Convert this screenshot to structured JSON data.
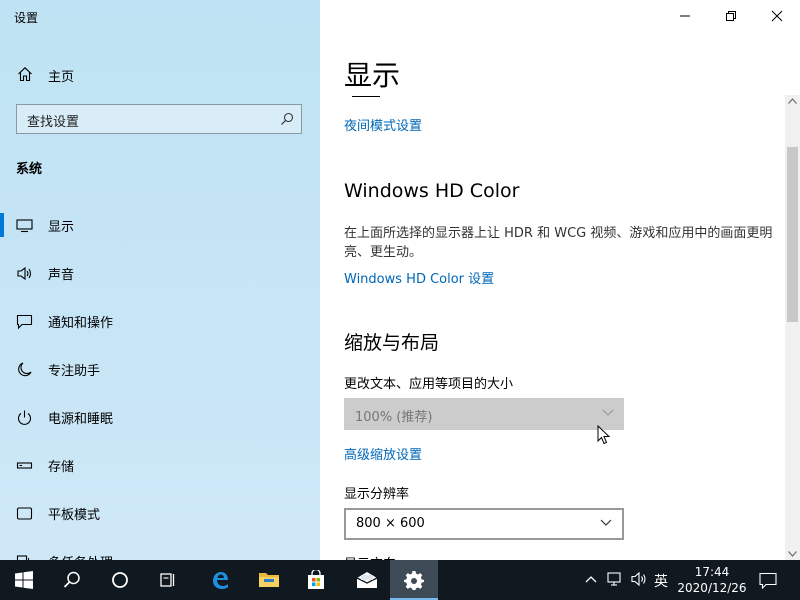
{
  "window": {
    "title": "设置",
    "controls": {
      "minimize": "minimize-icon",
      "restore": "restore-icon",
      "close": "close-icon"
    }
  },
  "sidebar": {
    "home_label": "主页",
    "search_placeholder": "查找设置",
    "section_title": "系统",
    "items": [
      {
        "label": "显示",
        "icon": "monitor-icon",
        "active": true
      },
      {
        "label": "声音",
        "icon": "speaker-icon"
      },
      {
        "label": "通知和操作",
        "icon": "notification-icon"
      },
      {
        "label": "专注助手",
        "icon": "moon-icon"
      },
      {
        "label": "电源和睡眠",
        "icon": "power-icon"
      },
      {
        "label": "存储",
        "icon": "storage-icon"
      },
      {
        "label": "平板模式",
        "icon": "tablet-icon"
      },
      {
        "label": "多任务处理",
        "icon": "multitask-icon"
      }
    ]
  },
  "main": {
    "page_title": "显示",
    "night_light_link": "夜间模式设置",
    "hd_color": {
      "heading": "Windows HD Color",
      "description": "在上面所选择的显示器上让 HDR 和 WCG 视频、游戏和应用中的画面更明亮、更生动。",
      "link": "Windows HD Color 设置"
    },
    "scale_layout": {
      "heading": "缩放与布局",
      "scale_label": "更改文本、应用等项目的大小",
      "scale_value": "100% (推荐)",
      "advanced_link": "高级缩放设置",
      "resolution_label": "显示分辨率",
      "resolution_value": "800 × 600",
      "orientation_label_partial": "显示方向"
    }
  },
  "taskbar": {
    "items": [
      "start-icon",
      "search-icon",
      "cortana-icon",
      "task-view-icon",
      "edge-icon",
      "file-explorer-icon",
      "store-icon",
      "mail-icon",
      "settings-icon"
    ],
    "active_item": "settings-icon",
    "ime": "英",
    "time": "17:44",
    "date": "2020/12/26"
  },
  "colors": {
    "accent": "#0078d7",
    "link": "#0067b8",
    "taskbar": "#101820",
    "sidebar": "#c6e5f6"
  }
}
